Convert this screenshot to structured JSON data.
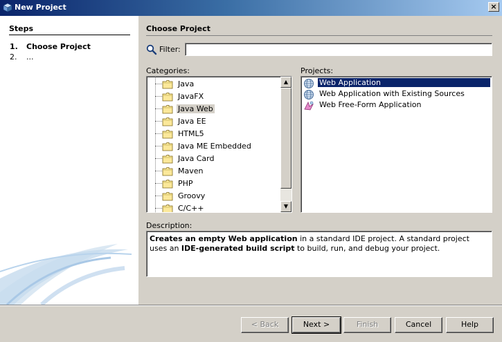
{
  "window": {
    "title": "New Project",
    "close_glyph": "×"
  },
  "steps": {
    "header": "Steps",
    "items": [
      {
        "num": "1.",
        "label": "Choose Project",
        "current": true
      },
      {
        "num": "2.",
        "label": "...",
        "current": false
      }
    ]
  },
  "content": {
    "title": "Choose Project",
    "filter": {
      "label": "Filter:",
      "value": ""
    },
    "categories_label": "Categories:",
    "projects_label": "Projects:",
    "description_label": "Description:"
  },
  "categories": [
    {
      "label": "Java"
    },
    {
      "label": "JavaFX"
    },
    {
      "label": "Java Web",
      "selected": true
    },
    {
      "label": "Java EE"
    },
    {
      "label": "HTML5"
    },
    {
      "label": "Java ME Embedded"
    },
    {
      "label": "Java Card"
    },
    {
      "label": "Maven"
    },
    {
      "label": "PHP"
    },
    {
      "label": "Groovy"
    },
    {
      "label": "C/C++"
    }
  ],
  "projects": [
    {
      "label": "Web Application",
      "icon": "globe-icon",
      "selected": true
    },
    {
      "label": "Web Application with Existing Sources",
      "icon": "globe-icon"
    },
    {
      "label": "Web Free-Form Application",
      "icon": "freeform-icon"
    }
  ],
  "description": {
    "part1_bold": "Creates an empty Web application",
    "part2": " in a standard IDE project. A standard project uses an ",
    "part3_bold": "IDE-generated build script",
    "part4": " to build, run, and debug your project."
  },
  "buttons": {
    "back": "< Back",
    "next": "Next >",
    "finish": "Finish",
    "cancel": "Cancel",
    "help": "Help"
  },
  "colors": {
    "selection": "#0a246a",
    "category_selection": "#d4d0c8",
    "dialog_bg": "#d4d0c8"
  }
}
